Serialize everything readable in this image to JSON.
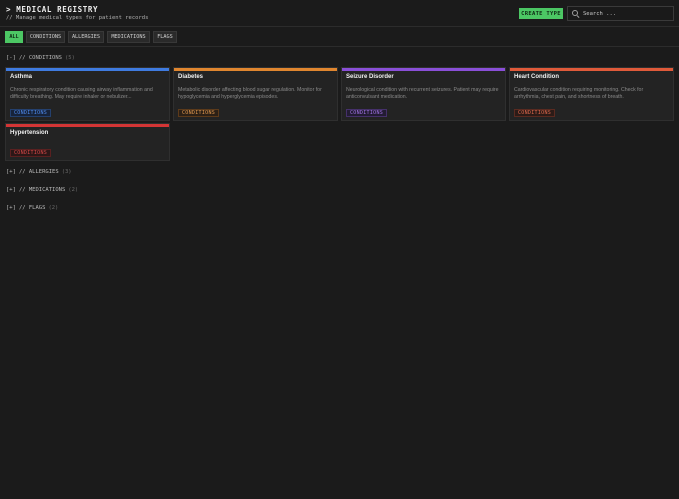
{
  "header": {
    "title": "> MEDICAL REGISTRY",
    "subtitle": "// Manage medical types for patient records",
    "create_label": "CREATE TYPE",
    "search_placeholder": "Search ..."
  },
  "filters": [
    {
      "label": "ALL",
      "active": true
    },
    {
      "label": "CONDITIONS",
      "active": false
    },
    {
      "label": "ALLERGIES",
      "active": false
    },
    {
      "label": "MEDICATIONS",
      "active": false
    },
    {
      "label": "FLAGS",
      "active": false
    }
  ],
  "sections": [
    {
      "toggle": "[-]",
      "label": "// CONDITIONS",
      "count": "(5)",
      "expanded": true
    },
    {
      "toggle": "[+]",
      "label": "// ALLERGIES",
      "count": "(3)",
      "expanded": false
    },
    {
      "toggle": "[+]",
      "label": "// MEDICATIONS",
      "count": "(2)",
      "expanded": false
    },
    {
      "toggle": "[+]",
      "label": "// FLAGS",
      "count": "(2)",
      "expanded": false
    }
  ],
  "cards": [
    {
      "title": "Asthma",
      "description": "Chronic respiratory condition causing airway inflammation and difficulty breathing. May require inhaler or nebulizer...",
      "tag": "CONDITIONS",
      "color": "#3f7be0"
    },
    {
      "title": "Diabetes",
      "description": "Metabolic disorder affecting blood sugar regulation. Monitor for hypoglycemia and hyperglycemia episodes.",
      "tag": "CONDITIONS",
      "color": "#e0862f"
    },
    {
      "title": "Seizure Disorder",
      "description": "Neurological condition with recurrent seizures. Patient may require anticonvulsant medication.",
      "tag": "CONDITIONS",
      "color": "#8a4fd8"
    },
    {
      "title": "Heart Condition",
      "description": "Cardiovascular condition requiring monitoring. Check for arrhythmia, chest pain, and shortness of breath.",
      "tag": "CONDITIONS",
      "color": "#e05a3a"
    },
    {
      "title": "Hypertension",
      "description": "",
      "tag": "CONDITIONS",
      "color": "#d33535"
    }
  ],
  "colors": {
    "accent": "#4cc764",
    "background": "#1b1b1b"
  }
}
